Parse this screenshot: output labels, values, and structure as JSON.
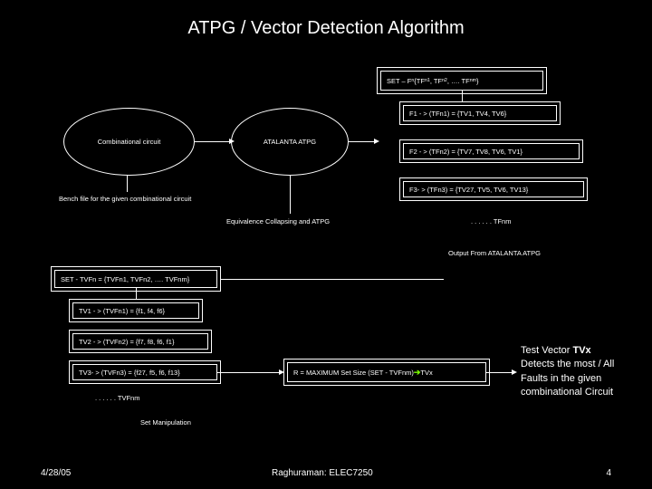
{
  "title": "ATPG / Vector Detection Algorithm",
  "top_set_box": "SET – F<sub>n</sub> {TF<sub>n1</sub>, TF<sub>n2</sub>, …. TF<sub>nm</sub>}",
  "combinational": "Combinational circuit",
  "atalanta": "ATALANTA ATPG",
  "f1": "F1 - > (TFn1) = {TV1, TV4, TV6}",
  "f2": "F2 - > (TFn2) =  {TV7, TV8, TV6, TV1}",
  "f3": "F3- > (TFn3) =  {TV27, TV5, TV6, TV13}",
  "dots_top": ". . . . . .  TFnm",
  "bench_label": "Bench file for the given combinational circuit",
  "collapsing": "Equivalence Collapsing and ATPG",
  "output_from": "Output From ATALANTA ATPG",
  "set_tvfn": "SET - TVFn = {TVFn1, TVFn2, …. TVFnm}",
  "tv1": "TV1 - > (TVFn1) = {f1, f4, f6}",
  "tv2": "TV2 - > (TVFn2) = {f7, f8, f6, f1}",
  "tv3": "TV3- > (TVFn3) =  {f27, f5, f6, f13}",
  "dots_bottom": ". . . . . .  TVFnm",
  "set_manipulation": "Set Manipulation",
  "r_box": "R = MAXIMUM Set Size (SET - TVFnm)  <span class='green-arrow'>➔</span>  TVx",
  "result": "Test Vector <b>TVx</b><br>Detects the most / All<br>Faults in the given<br>combinational Circuit",
  "footer_left": "4/28/05",
  "footer_center": "Raghuraman: ELEC7250",
  "footer_right": "4"
}
